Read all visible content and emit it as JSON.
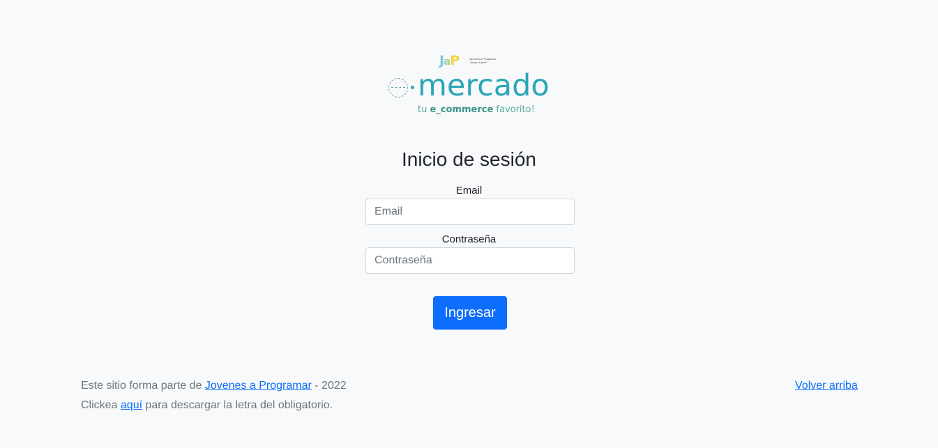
{
  "logo": {
    "jap_mark": {
      "j": "J",
      "a": "a",
      "p": "P"
    },
    "jap_subtitle_line1": "Jóvenes a Programar",
    "jap_subtitle_line2": "\"Alvaro Lamé\"",
    "brand_word": "mercado",
    "tagline_pre": "tu ",
    "tagline_bold": "e_commerce",
    "tagline_post": " favorito!"
  },
  "login": {
    "title": "Inicio de sesión",
    "email_label": "Email",
    "email_placeholder": "Email",
    "email_value": "",
    "password_label": "Contraseña",
    "password_placeholder": "Contraseña",
    "password_value": "",
    "submit_label": "Ingresar"
  },
  "footer": {
    "line1_pre": "Este sitio forma parte de ",
    "line1_link": "Jovenes a Programar",
    "line1_post": " - 2022",
    "line2_pre": "Clickea ",
    "line2_link": "aquí",
    "line2_post": " para descargar la letra del obligatorio.",
    "back_to_top": "Volver arriba"
  },
  "colors": {
    "primary": "#0d6efd",
    "brand_teal": "#2ba6b6",
    "tagline_green": "#56aa9a",
    "background": "#f8f9fa",
    "muted_text": "#6c757d"
  }
}
